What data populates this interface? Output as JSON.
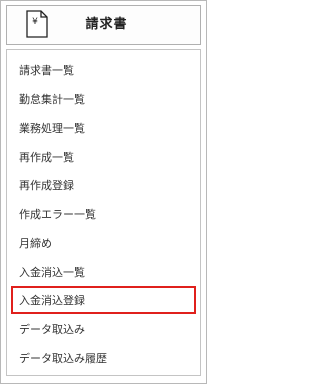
{
  "header": {
    "title": "請求書",
    "icon": "document-yen-icon",
    "icon_glyph": "¥"
  },
  "menu": {
    "items": [
      {
        "label": "請求書一覧"
      },
      {
        "label": "勤怠集計一覧"
      },
      {
        "label": "業務処理一覧"
      },
      {
        "label": "再作成一覧"
      },
      {
        "label": "再作成登録"
      },
      {
        "label": "作成エラー一覧"
      },
      {
        "label": "月締め"
      },
      {
        "label": "入金消込一覧"
      },
      {
        "label": "入金消込登録",
        "highlighted": true
      },
      {
        "label": "データ取込み"
      },
      {
        "label": "データ取込み履歴"
      }
    ]
  },
  "colors": {
    "highlight": "#e0201c",
    "border": "#b8b8b8",
    "text": "#333333"
  }
}
